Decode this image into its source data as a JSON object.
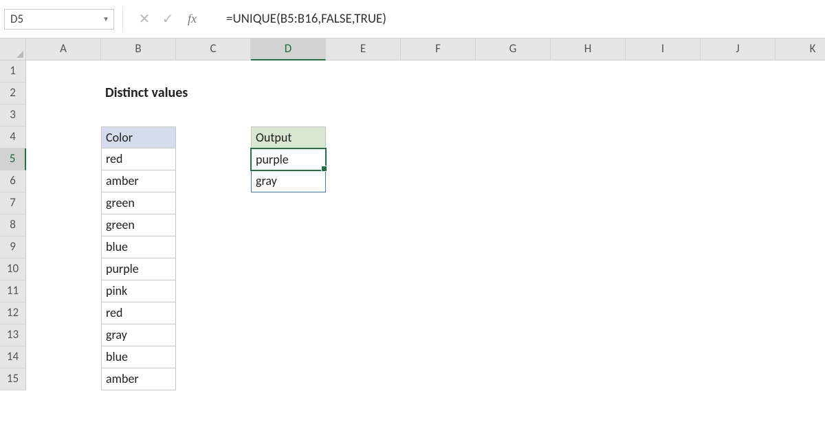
{
  "name_box": "D5",
  "formula": "=UNIQUE(B5:B16,FALSE,TRUE)",
  "fx_label": "fx",
  "columns": [
    "A",
    "B",
    "C",
    "D",
    "E",
    "F",
    "G",
    "H",
    "I",
    "J",
    "K"
  ],
  "rows": [
    "1",
    "2",
    "3",
    "4",
    "5",
    "6",
    "7",
    "8",
    "9",
    "10",
    "11",
    "12",
    "13",
    "14",
    "15"
  ],
  "active_col": "D",
  "active_row": "5",
  "title": "Distinct values",
  "headers": {
    "color": "Color",
    "output": "Output"
  },
  "color_values": [
    "red",
    "amber",
    "green",
    "green",
    "blue",
    "purple",
    "pink",
    "red",
    "gray",
    "blue",
    "amber"
  ],
  "output_values": [
    "purple",
    "gray"
  ]
}
